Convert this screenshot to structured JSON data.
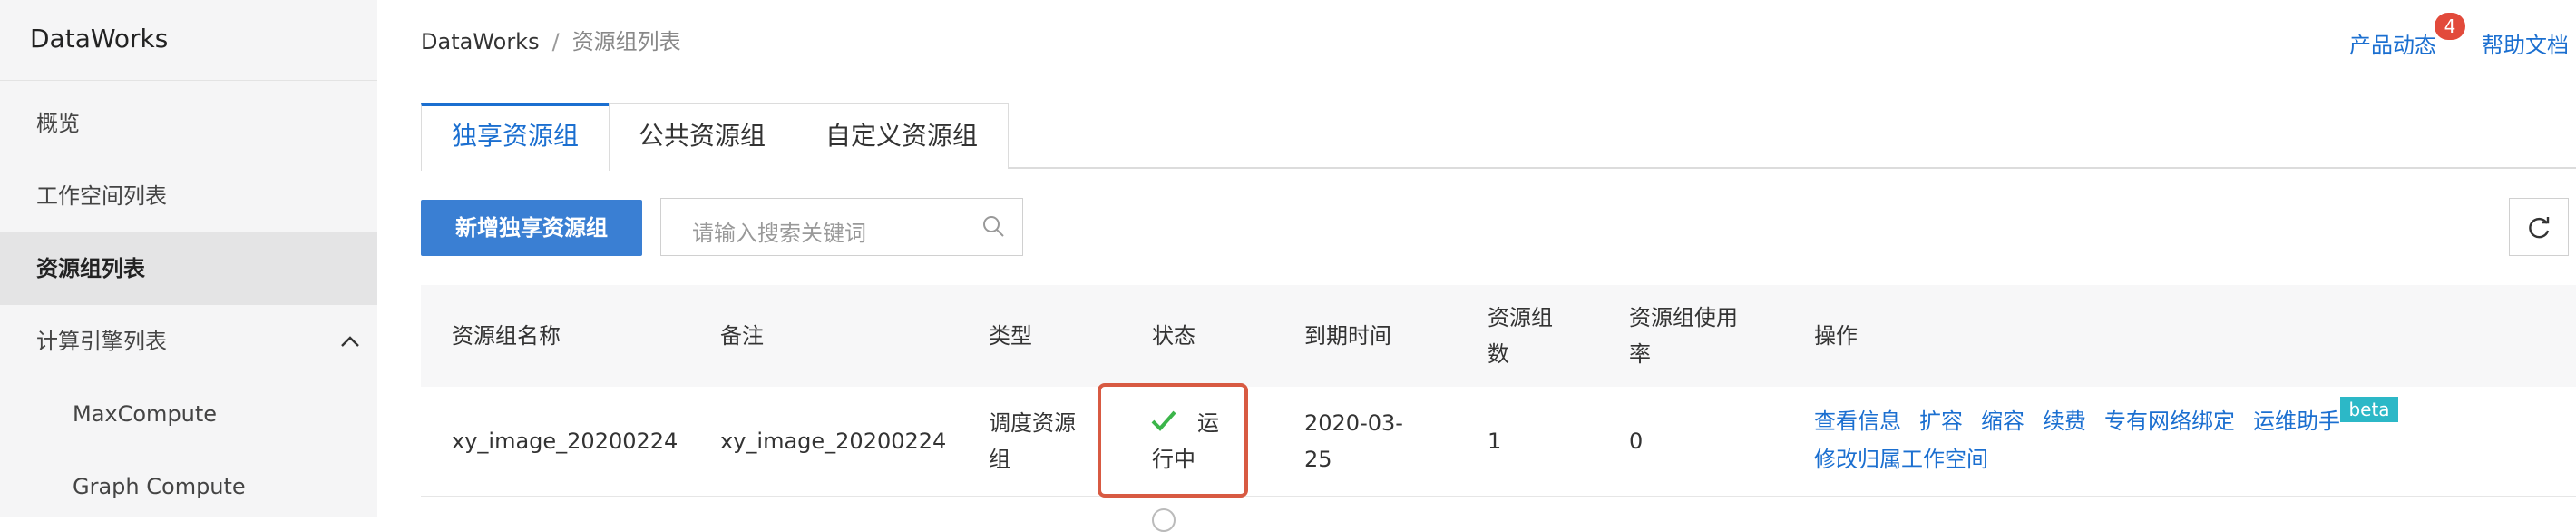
{
  "sidebar": {
    "logo": "DataWorks",
    "items": [
      {
        "label": "概览"
      },
      {
        "label": "工作空间列表"
      },
      {
        "label": "资源组列表",
        "active": true
      },
      {
        "label": "计算引擎列表",
        "expandable": true
      },
      {
        "label": "MaxCompute",
        "sub": true
      },
      {
        "label": "Graph Compute",
        "sub": true
      }
    ]
  },
  "header": {
    "breadcrumb": {
      "root": "DataWorks",
      "separator": "/",
      "current": "资源组列表"
    },
    "links": {
      "product_news": "产品动态",
      "product_news_badge": "4",
      "help": "帮助文档"
    }
  },
  "tabs": [
    {
      "label": "独享资源组",
      "active": true
    },
    {
      "label": "公共资源组"
    },
    {
      "label": "自定义资源组"
    }
  ],
  "toolbar": {
    "new_button": "新增独享资源组",
    "search_placeholder": "请输入搜索关键词",
    "refresh_icon": "refresh-icon"
  },
  "table": {
    "columns": [
      "资源组名称",
      "备注",
      "类型",
      "状态",
      "到期时间",
      "资源组数",
      "资源组使用率",
      "操作"
    ],
    "rows": [
      {
        "name": "xy_image_20200224",
        "remark": "xy_image_20200224",
        "type": "调度资源组",
        "status": "运行中",
        "expire": "2020-03-25",
        "count": "1",
        "usage": "0",
        "actions": [
          "查看信息",
          "扩容",
          "缩容",
          "续费",
          "专有网络绑定",
          "运维助手",
          "修改归属工作空间"
        ],
        "beta_tag": "beta"
      }
    ]
  },
  "colors": {
    "accent": "#1b6fd0",
    "primary_button": "#3a7fd3",
    "highlight_box": "#d85a42",
    "success": "#3bb54a",
    "beta": "#2cb8c7"
  }
}
